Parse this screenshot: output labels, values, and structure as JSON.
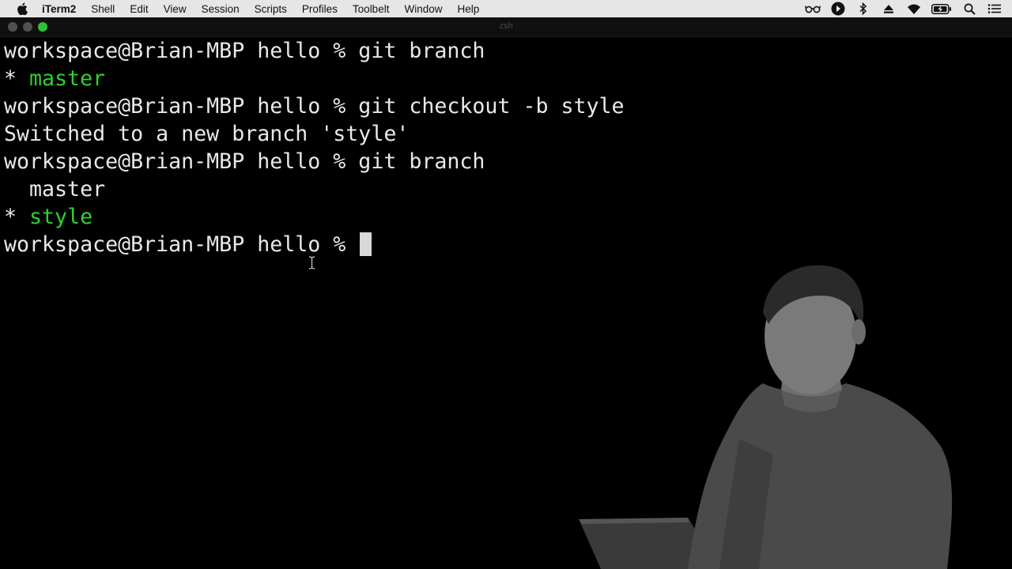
{
  "menubar": {
    "app_name": "iTerm2",
    "items": [
      "Shell",
      "Edit",
      "View",
      "Session",
      "Scripts",
      "Profiles",
      "Toolbelt",
      "Window",
      "Help"
    ]
  },
  "status_icons": [
    "glasses-icon",
    "media-play-icon",
    "bluetooth-icon",
    "eject-icon",
    "wifi-icon",
    "battery-charging-icon",
    "search-icon",
    "list-icon"
  ],
  "window": {
    "title": "zsh"
  },
  "terminal": {
    "lines": [
      {
        "text": "workspace@Brian-MBP hello % git branch"
      },
      {
        "prefix": "* ",
        "highlight": "master"
      },
      {
        "text": "workspace@Brian-MBP hello % git checkout -b style"
      },
      {
        "text": "Switched to a new branch 'style'"
      },
      {
        "text": "workspace@Brian-MBP hello % git branch"
      },
      {
        "text": "  master"
      },
      {
        "prefix": "* ",
        "highlight": "style"
      },
      {
        "text": "workspace@Brian-MBP hello % "
      }
    ]
  },
  "colors": {
    "background": "#000000",
    "foreground": "#e9e9e9",
    "branch_highlight": "#2fd12f",
    "zoom_button": "#2fc03a"
  }
}
